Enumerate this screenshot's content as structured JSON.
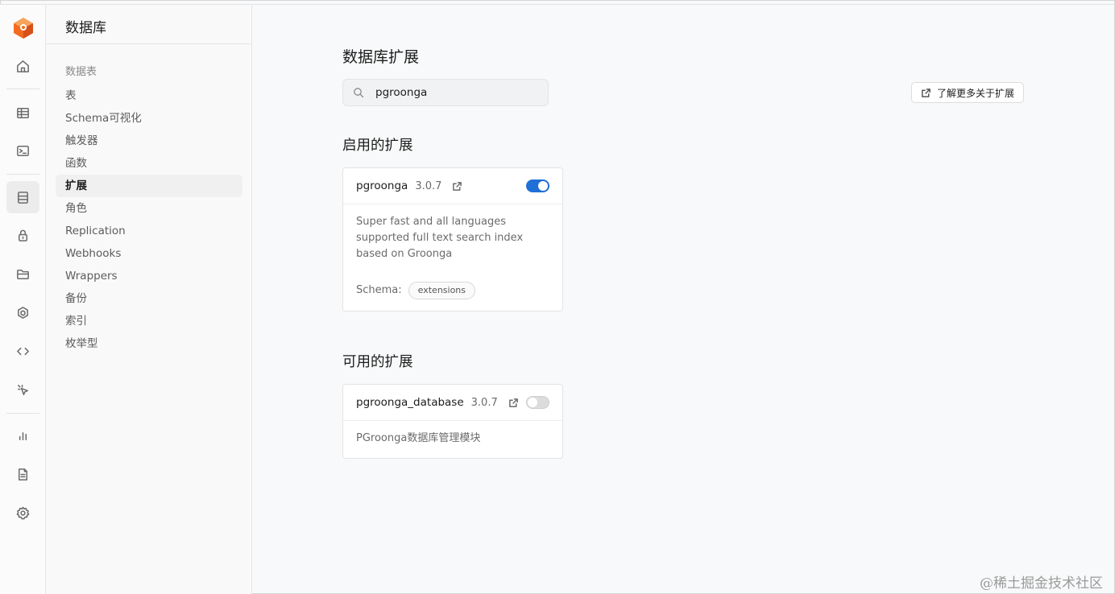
{
  "menu": {
    "title": "数据库",
    "group_label": "数据表",
    "items": [
      {
        "label": "表"
      },
      {
        "label": "Schema可视化"
      },
      {
        "label": "触发器"
      },
      {
        "label": "函数"
      },
      {
        "label": "扩展",
        "active": true
      },
      {
        "label": "角色"
      },
      {
        "label": "Replication"
      },
      {
        "label": "Webhooks"
      },
      {
        "label": "Wrappers"
      },
      {
        "label": "备份"
      },
      {
        "label": "索引"
      },
      {
        "label": "枚举型"
      }
    ]
  },
  "rail": {
    "icons": [
      "home-icon",
      "table-editor-icon",
      "sql-editor-icon",
      "database-icon",
      "auth-icon",
      "storage-icon",
      "edge-functions-icon",
      "api-icon",
      "realtime-icon",
      "reports-icon",
      "logs-icon",
      "settings-icon"
    ]
  },
  "main": {
    "title": "数据库扩展",
    "search": {
      "value": "pgroonga",
      "placeholder": ""
    },
    "docs_button": "了解更多关于扩展",
    "enabled_title": "启用的扩展",
    "available_title": "可用的扩展",
    "enabled": [
      {
        "name": "pgroonga",
        "version": "3.0.7",
        "enabled": true,
        "description": "Super fast and all languages supported full text search index based on Groonga",
        "schema_label": "Schema:",
        "schema": "extensions"
      }
    ],
    "available": [
      {
        "name": "pgroonga_database",
        "version": "3.0.7",
        "enabled": false,
        "description": "PGroonga数据库管理模块"
      }
    ]
  },
  "colors": {
    "accent": "#1f6fd6",
    "logo": "#f26b21"
  },
  "watermark": "@稀土掘金技术社区"
}
